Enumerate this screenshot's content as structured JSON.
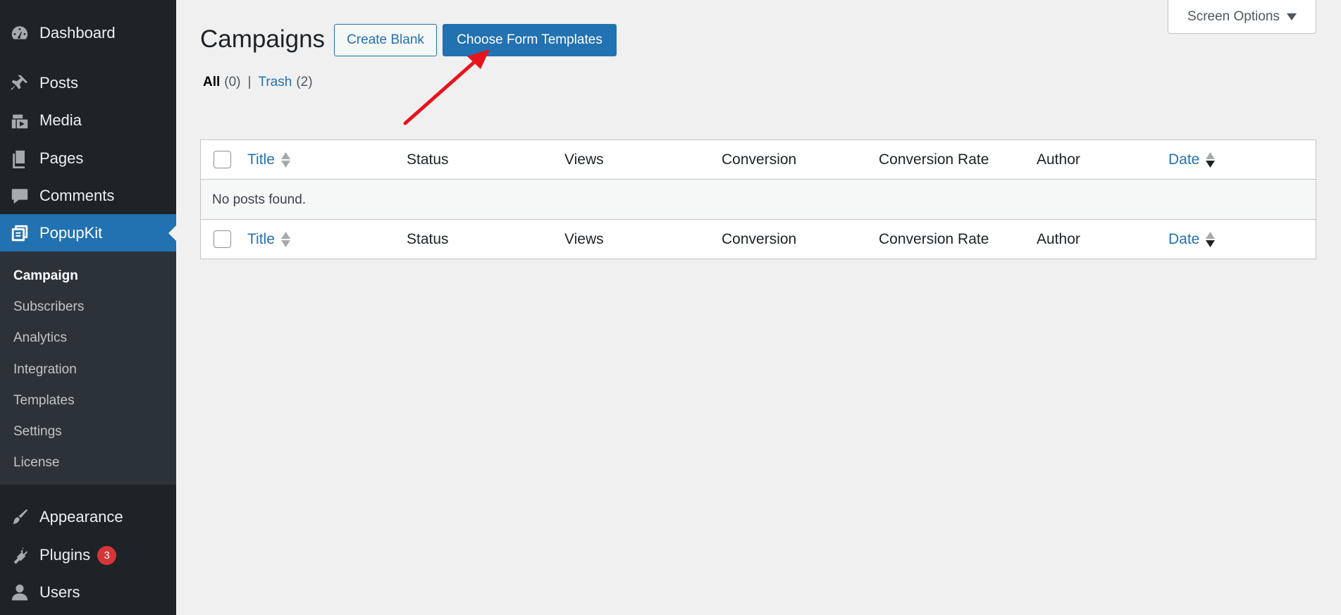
{
  "sidebar": {
    "items": [
      {
        "label": "Dashboard",
        "icon": "dashboard-icon"
      },
      {
        "label": "Posts",
        "icon": "pin-icon"
      },
      {
        "label": "Media",
        "icon": "media-icon"
      },
      {
        "label": "Pages",
        "icon": "pages-icon"
      },
      {
        "label": "Comments",
        "icon": "comment-icon"
      },
      {
        "label": "PopupKit",
        "icon": "popupkit-icon"
      },
      {
        "label": "Appearance",
        "icon": "brush-icon"
      },
      {
        "label": "Plugins",
        "icon": "plugin-icon",
        "badge": "3"
      },
      {
        "label": "Users",
        "icon": "user-icon"
      }
    ],
    "submenu": [
      "Campaign",
      "Subscribers",
      "Analytics",
      "Integration",
      "Templates",
      "Settings",
      "License"
    ]
  },
  "header": {
    "title": "Campaigns",
    "create_blank": "Create Blank",
    "choose_templates": "Choose Form Templates",
    "screen_options": "Screen Options"
  },
  "filters": {
    "all_label": "All",
    "all_count": "(0)",
    "separator": "|",
    "trash_label": "Trash",
    "trash_count": "(2)"
  },
  "table": {
    "columns": [
      "Title",
      "Status",
      "Views",
      "Conversion",
      "Conversion Rate",
      "Author",
      "Date"
    ],
    "empty_message": "No posts found."
  },
  "colors": {
    "accent": "#2271b1",
    "sidebar_bg": "#1d2327",
    "annotation_arrow": "#e8141c"
  }
}
